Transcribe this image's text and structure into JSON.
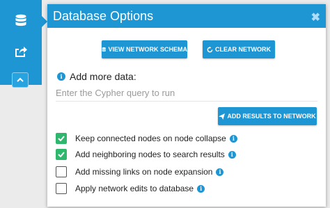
{
  "sidebar": {
    "icons": [
      "database-icon",
      "share-icon",
      "chevron-up-icon"
    ]
  },
  "panel": {
    "title": "Database Options",
    "close_glyph": "✖"
  },
  "buttons": {
    "view_schema": "VIEW NETWORK SCHEMA",
    "clear_network": "CLEAR NETWORK",
    "add_results": "ADD RESULTS TO NETWORK"
  },
  "query": {
    "label": "Add more data:",
    "placeholder": "Enter the Cypher query to run",
    "value": ""
  },
  "options": [
    {
      "label": "Keep connected nodes on node collapse",
      "checked": true
    },
    {
      "label": "Add neighboring nodes to search results",
      "checked": true
    },
    {
      "label": "Add missing links on node expansion",
      "checked": false
    },
    {
      "label": "Apply network edits to database",
      "checked": false
    }
  ],
  "colors": {
    "primary": "#1e96d4",
    "checkbox_checked": "#2fb86d",
    "background": "#ebebeb"
  }
}
